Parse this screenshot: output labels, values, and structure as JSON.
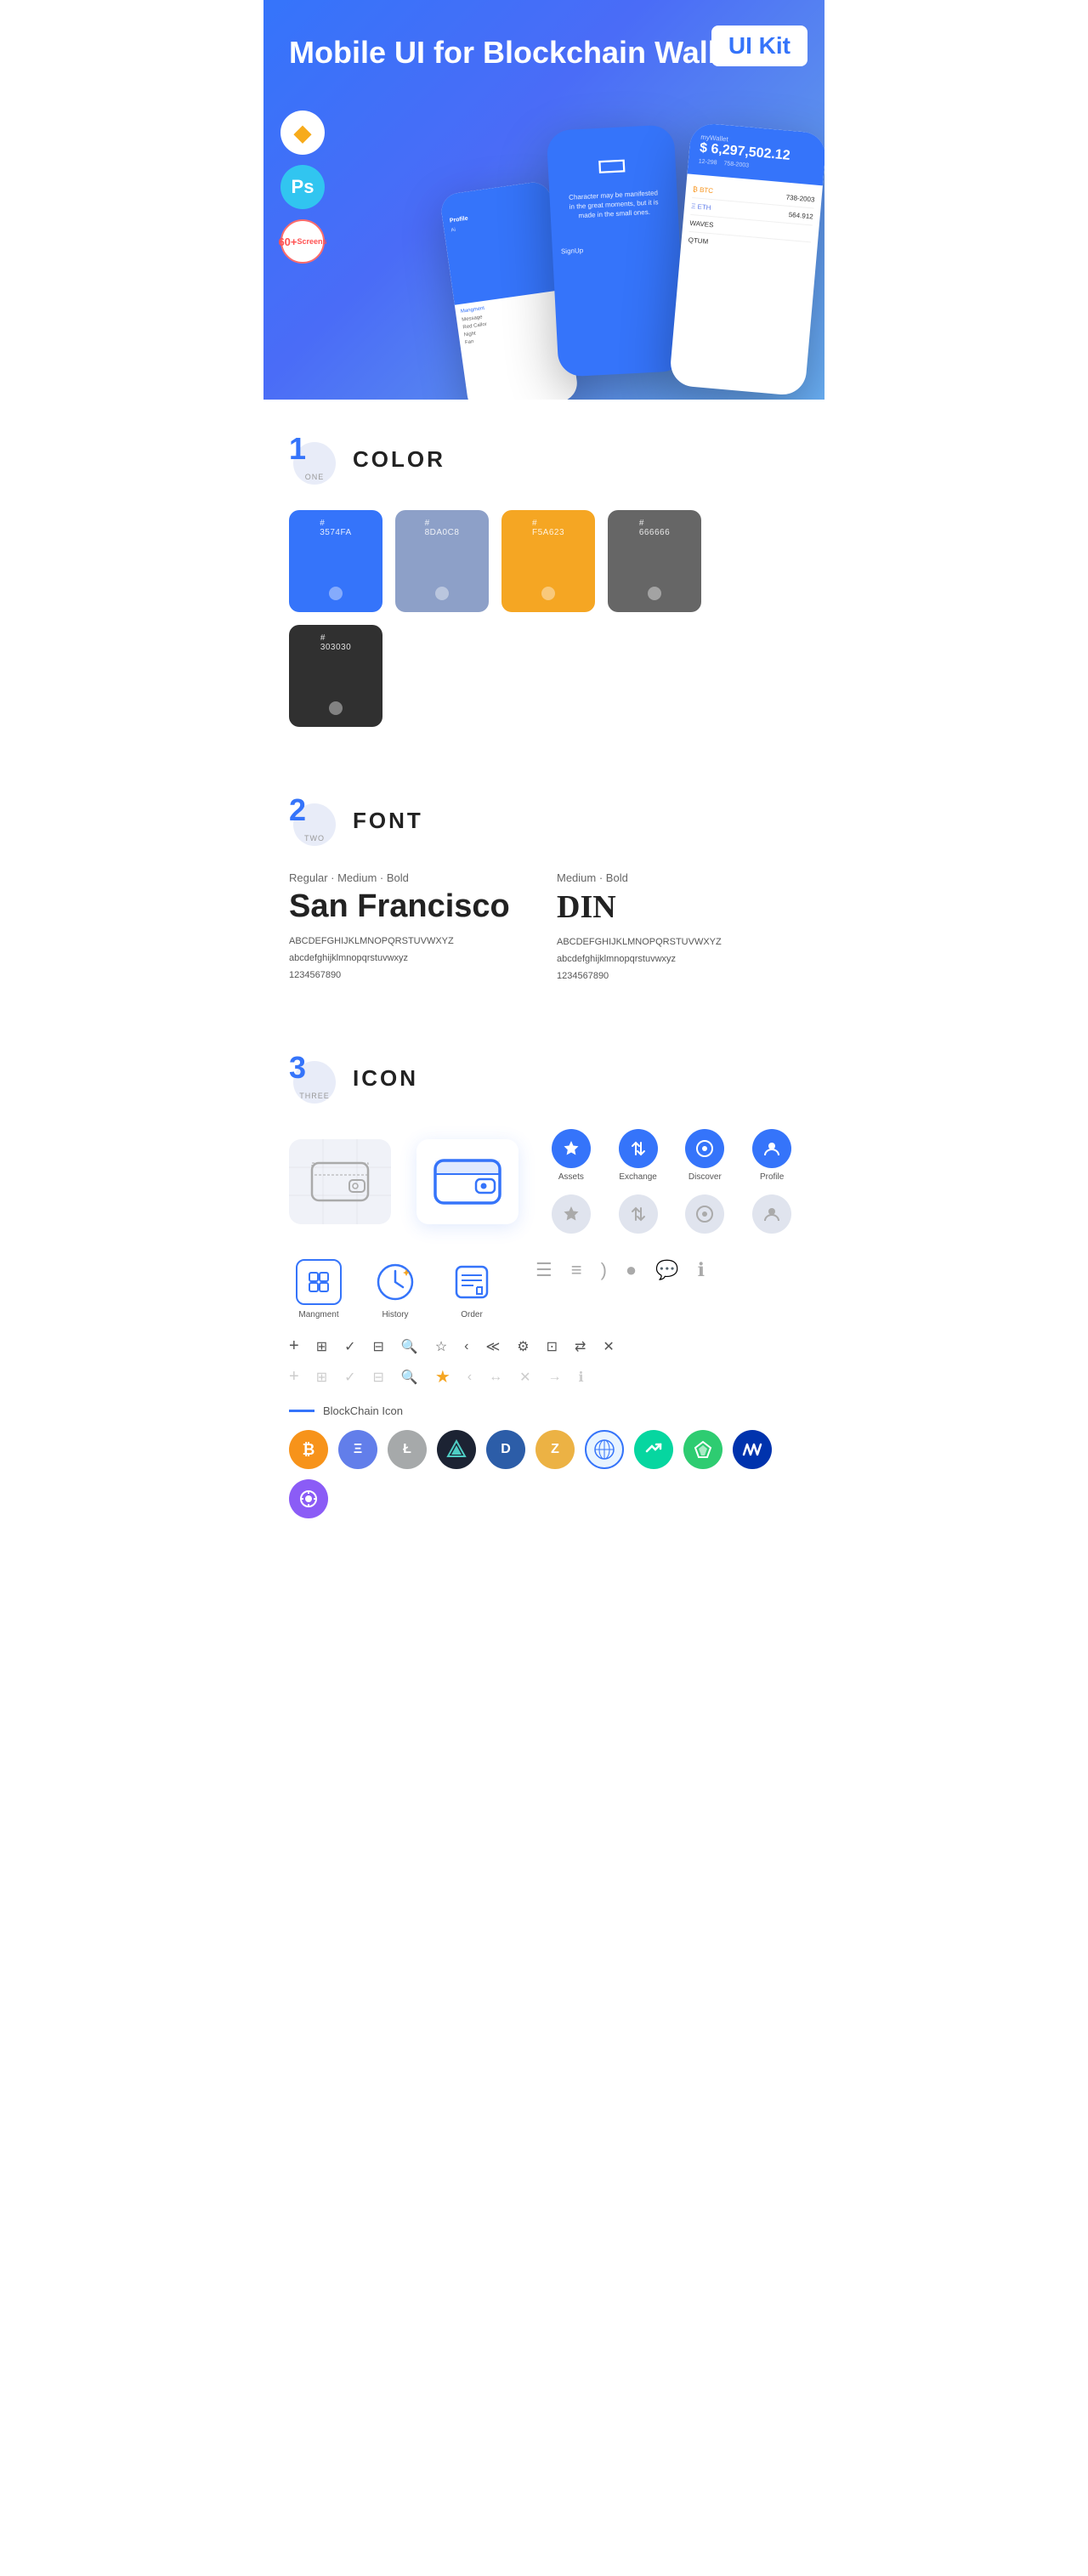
{
  "hero": {
    "title": "Mobile UI for Blockchain ",
    "title_bold": "Wallet",
    "badge": "UI Kit"
  },
  "badges": [
    {
      "id": "sketch",
      "label": "Sketch"
    },
    {
      "id": "ps",
      "label": "Ps"
    },
    {
      "id": "screens",
      "line1": "60+",
      "line2": "Screens"
    }
  ],
  "sections": {
    "color": {
      "num": "1",
      "num_label": "ONE",
      "title": "COLOR",
      "swatches": [
        {
          "hex": "#3574FA",
          "label": "#\n3574FA"
        },
        {
          "hex": "#8DA0C8",
          "label": "#\n8DA0C8"
        },
        {
          "hex": "#F5A623",
          "label": "#\nF5A623"
        },
        {
          "hex": "#666666",
          "label": "#\n666666"
        },
        {
          "hex": "#303030",
          "label": "#\n303030"
        }
      ]
    },
    "font": {
      "num": "2",
      "num_label": "TWO",
      "title": "FONT",
      "fonts": [
        {
          "label": "Regular · Medium · Bold",
          "name": "San Francisco",
          "uppercase": "ABCDEFGHIJKLMNOPQRSTUVWXYZ",
          "lowercase": "abcdefghijklmnopqrstuvwxyz",
          "numbers": "1234567890"
        },
        {
          "label": "Medium · Bold",
          "name": "DIN",
          "uppercase": "ABCDEFGHIJKLMNOPQRSTUVWXYZ",
          "lowercase": "abcdefghijklmnopqrstuvwxyz",
          "numbers": "1234567890"
        }
      ]
    },
    "icon": {
      "num": "3",
      "num_label": "THREE",
      "title": "ICON",
      "nav_icons": [
        {
          "label": "Assets"
        },
        {
          "label": "Exchange"
        },
        {
          "label": "Discover"
        },
        {
          "label": "Profile"
        }
      ],
      "mgmt_icons": [
        {
          "label": "Mangment"
        },
        {
          "label": "History"
        },
        {
          "label": "Order"
        }
      ],
      "tool_icons": [
        "+",
        "⊞",
        "✓",
        "⊟",
        "🔍",
        "☆",
        "<",
        "≪",
        "⚙",
        "⊡",
        "⇄",
        "✕"
      ],
      "blockchain_label": "BlockChain Icon",
      "crypto_coins": [
        {
          "symbol": "₿",
          "color": "#F7931A",
          "name": "Bitcoin"
        },
        {
          "symbol": "Ξ",
          "color": "#627EEA",
          "name": "Ethereum"
        },
        {
          "symbol": "Ł",
          "color": "#A6A9AA",
          "name": "Litecoin"
        },
        {
          "symbol": "◈",
          "color": "#2C3E50",
          "name": "Verge"
        },
        {
          "symbol": "D",
          "color": "#2C5DA8",
          "name": "Dash"
        },
        {
          "symbol": "Z",
          "color": "#1C1C1C",
          "name": "Zcash"
        },
        {
          "symbol": "⬡",
          "color": "#7B5EA7",
          "name": "Waves"
        },
        {
          "symbol": "⟁",
          "color": "#4CAF50",
          "name": "Steem"
        },
        {
          "symbol": "◆",
          "color": "#4CAF50",
          "name": "Augur"
        },
        {
          "symbol": "◈",
          "color": "#0033AD",
          "name": "Matic"
        },
        {
          "symbol": "∞",
          "color": "#8B5CF6",
          "name": "Bancor"
        }
      ]
    }
  }
}
